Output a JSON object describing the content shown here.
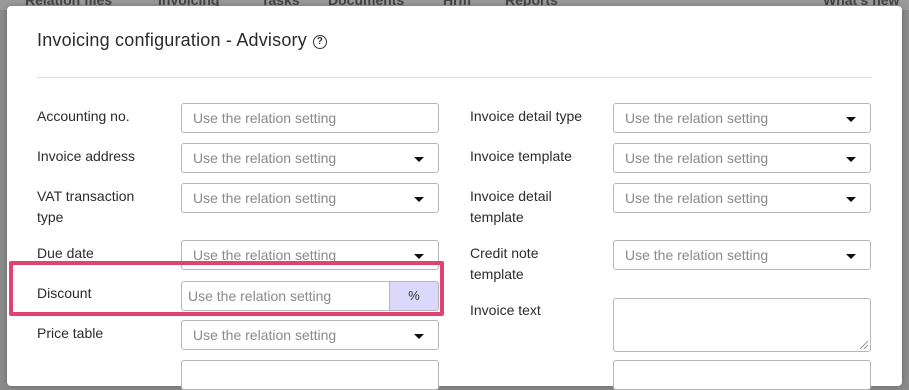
{
  "background_nav": {
    "items": [
      "Relation files",
      "Invoicing",
      "Tasks",
      "Documents",
      "Hrm",
      "Reports",
      "What's new"
    ]
  },
  "modal": {
    "title": "Invoicing configuration - Advisory",
    "help_icon_glyph": "?"
  },
  "placeholder": "Use the relation setting",
  "left_fields": [
    {
      "label": "Accounting no.",
      "kind": "text"
    },
    {
      "label": "Invoice address",
      "kind": "select"
    },
    {
      "label": "VAT transaction type",
      "kind": "select"
    },
    {
      "label": "Due date",
      "kind": "select"
    },
    {
      "label": "Discount",
      "kind": "percent",
      "addon": "%"
    },
    {
      "label": "Price table",
      "kind": "select"
    }
  ],
  "right_fields": [
    {
      "label": "Invoice detail type",
      "kind": "select"
    },
    {
      "label": "Invoice template",
      "kind": "select"
    },
    {
      "label": "Invoice detail template",
      "kind": "select"
    },
    {
      "label": "Credit note template",
      "kind": "select"
    },
    {
      "label": "Invoice text",
      "kind": "textarea"
    }
  ],
  "colors": {
    "highlight": "#e0436f",
    "percent_addon_bg": "#dcd8fb"
  }
}
